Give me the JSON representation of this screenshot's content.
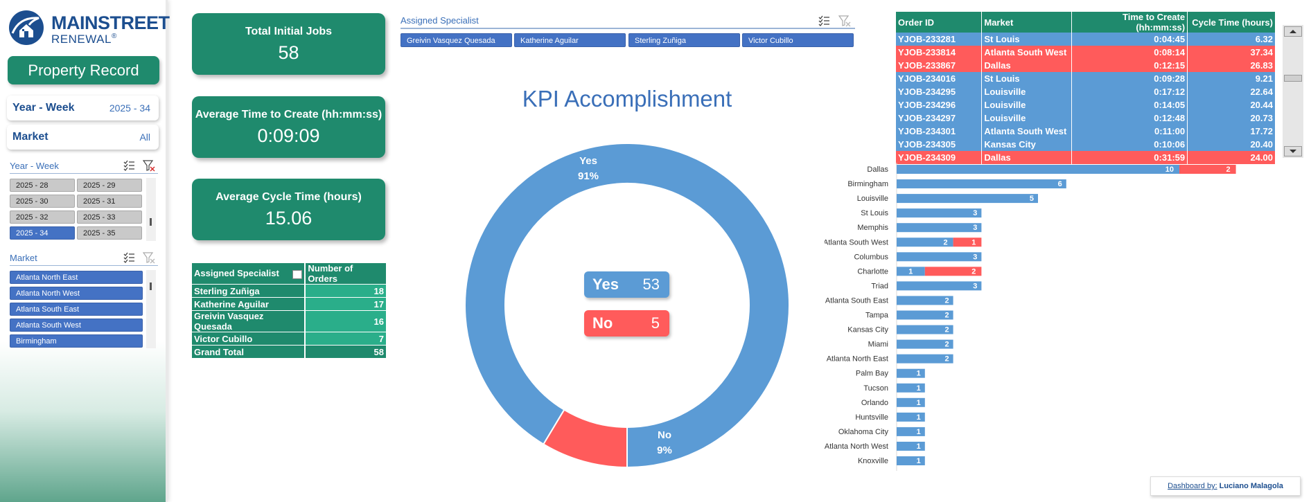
{
  "logo": {
    "main": "MAINSTREET",
    "sub": "RENEWAL",
    "reg": "®"
  },
  "sidebar": {
    "title_button": "Property Record",
    "year_week_card": {
      "label": "Year - Week",
      "value": "2025 - 34"
    },
    "market_card": {
      "label": "Market",
      "value": "All"
    },
    "year_week_slicer": {
      "title": "Year - Week",
      "items": [
        "2025 - 28",
        "2025 - 29",
        "2025 - 30",
        "2025 - 31",
        "2025 - 32",
        "2025 - 33",
        "2025 - 34",
        "2025 - 35"
      ],
      "selected": "2025 - 34"
    },
    "market_slicer": {
      "title": "Market",
      "items": [
        "Atlanta North East",
        "Atlanta North West",
        "Atlanta South East",
        "Atlanta South West",
        "Birmingham"
      ]
    }
  },
  "kpis": [
    {
      "title": "Total Initial Jobs",
      "value": "58"
    },
    {
      "title": "Average Time to Create (hh:mm:ss)",
      "value": "0:09:09"
    },
    {
      "title": "Average Cycle Time (hours)",
      "value": "15.06"
    }
  ],
  "pivot": {
    "headers": [
      "Assigned Specialist",
      "Number of Orders"
    ],
    "rows": [
      {
        "name": "Sterling Zuñiga",
        "count": "18"
      },
      {
        "name": "Katherine Aguilar",
        "count": "17"
      },
      {
        "name": "Greivin Vasquez Quesada",
        "count": "16"
      },
      {
        "name": "Victor Cubillo",
        "count": "7"
      }
    ],
    "total_label": "Grand Total",
    "total_value": "58"
  },
  "specialist_slicer": {
    "title": "Assigned Specialist",
    "items": [
      "Greivin Vasquez Quesada",
      "Katherine Aguilar",
      "Sterling Zuñiga",
      "Victor Cubillo"
    ]
  },
  "kpi_chart_title": "KPI Accomplishment",
  "legend": {
    "yes_label": "Yes",
    "yes_value": "53",
    "no_label": "No",
    "no_value": "5"
  },
  "colors": {
    "green": "#1f8a6d",
    "blue": "#5b9bd5",
    "red": "#ff5b5b",
    "slicer_blue": "#4472c4",
    "navy": "#1c4e8f"
  },
  "orders": {
    "headers": [
      "Order ID",
      "Market",
      "Time to Create (hh:mm:ss)",
      "Cycle Time (hours)"
    ],
    "rows": [
      {
        "id": "YJOB-233281",
        "market": "St Louis",
        "time": "0:04:45",
        "cycle": "6.32",
        "status": "ok"
      },
      {
        "id": "YJOB-233814",
        "market": "Atlanta South West",
        "time": "0:08:14",
        "cycle": "37.34",
        "status": "late"
      },
      {
        "id": "YJOB-233867",
        "market": "Dallas",
        "time": "0:12:15",
        "cycle": "26.83",
        "status": "late"
      },
      {
        "id": "YJOB-234016",
        "market": "St Louis",
        "time": "0:09:28",
        "cycle": "9.21",
        "status": "ok"
      },
      {
        "id": "YJOB-234295",
        "market": "Louisville",
        "time": "0:17:12",
        "cycle": "22.64",
        "status": "ok"
      },
      {
        "id": "YJOB-234296",
        "market": "Louisville",
        "time": "0:14:05",
        "cycle": "20.44",
        "status": "ok"
      },
      {
        "id": "YJOB-234297",
        "market": "Louisville",
        "time": "0:12:48",
        "cycle": "20.73",
        "status": "ok"
      },
      {
        "id": "YJOB-234301",
        "market": "Atlanta South West",
        "time": "0:11:00",
        "cycle": "17.72",
        "status": "ok"
      },
      {
        "id": "YJOB-234305",
        "market": "Kansas City",
        "time": "0:10:06",
        "cycle": "20.40",
        "status": "ok"
      },
      {
        "id": "YJOB-234309",
        "market": "Dallas",
        "time": "0:31:59",
        "cycle": "24.00",
        "status": "late"
      }
    ]
  },
  "credit": {
    "prefix": "Dashboard by:",
    "author": "Luciano Malagola"
  },
  "chart_data": [
    {
      "type": "pie",
      "title": "KPI Accomplishment",
      "categories": [
        "Yes",
        "No"
      ],
      "values": [
        53,
        5
      ],
      "percent_labels": [
        "91%",
        "9%"
      ],
      "donut": true
    },
    {
      "type": "bar",
      "orientation": "horizontal",
      "stacked": true,
      "categories": [
        "Dallas",
        "Birmingham",
        "Louisville",
        "St Louis",
        "Memphis",
        "Atlanta South West",
        "Columbus",
        "Charlotte",
        "Triad",
        "Atlanta South East",
        "Tampa",
        "Kansas City",
        "Miami",
        "Atlanta North East",
        "Palm Bay",
        "Tucson",
        "Orlando",
        "Huntsville",
        "Oklahoma City",
        "Atlanta North West",
        "Knoxville"
      ],
      "series": [
        {
          "values": [
            10,
            6,
            5,
            3,
            3,
            2,
            3,
            1,
            3,
            2,
            2,
            2,
            2,
            2,
            1,
            1,
            1,
            1,
            1,
            1,
            1
          ]
        },
        {
          "values": [
            2,
            0,
            0,
            0,
            0,
            1,
            0,
            2,
            0,
            0,
            0,
            0,
            0,
            0,
            0,
            0,
            0,
            0,
            0,
            0,
            0
          ]
        }
      ],
      "xlim": [
        0,
        12
      ]
    }
  ]
}
